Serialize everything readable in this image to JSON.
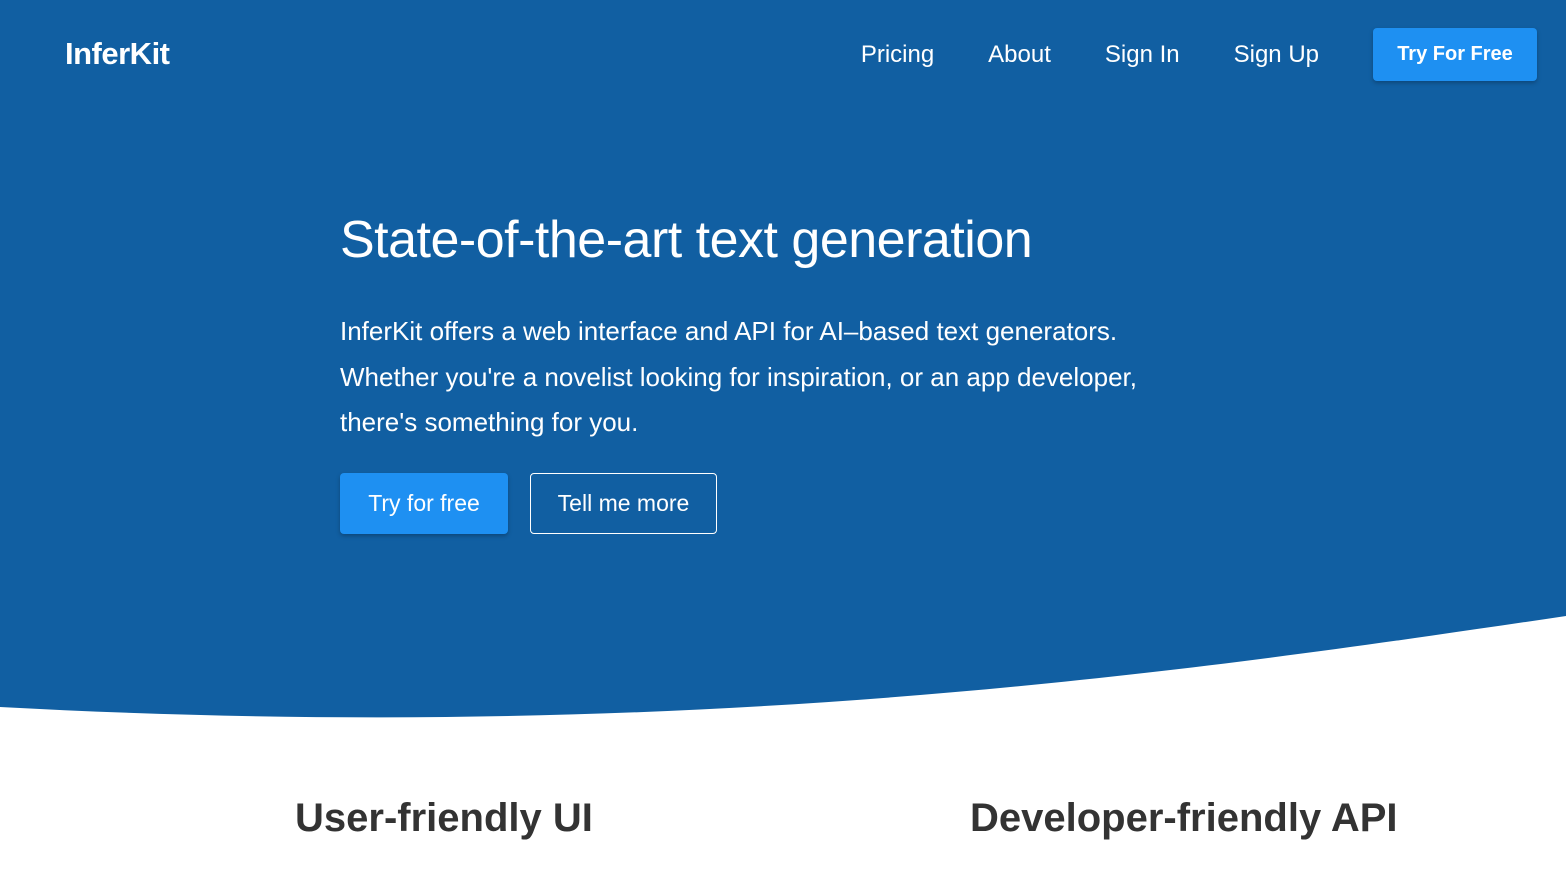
{
  "colors": {
    "hero_background": "#115fa2",
    "accent_button": "#1e90f2",
    "page_background": "#ffffff",
    "feature_heading": "#333333"
  },
  "header": {
    "logo": "InferKit",
    "nav": {
      "pricing": "Pricing",
      "about": "About",
      "sign_in": "Sign In",
      "sign_up": "Sign Up",
      "cta": "Try For Free"
    }
  },
  "hero": {
    "title": "State-of-the-art text generation",
    "description_lines": [
      "InferKit offers a web interface and API for AI–based text generators.",
      "Whether you're a novelist looking for inspiration, or an app developer,",
      "there's something for you."
    ],
    "primary_button": "Try for free",
    "secondary_button": "Tell me more"
  },
  "features": {
    "ui_title": "User-friendly UI",
    "api_title": "Developer-friendly API"
  }
}
